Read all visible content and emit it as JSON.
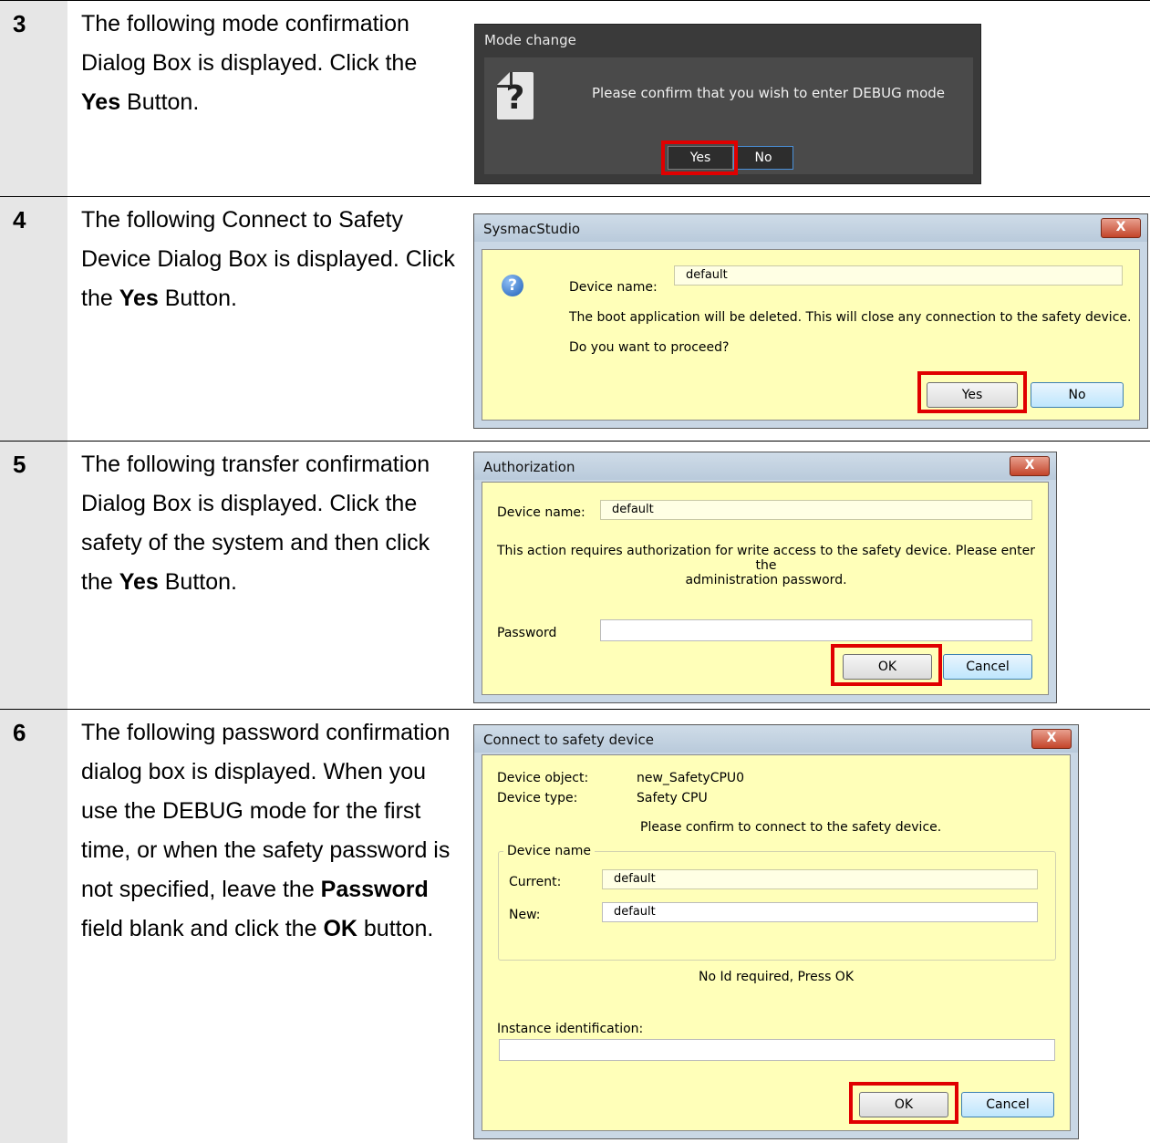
{
  "steps": [
    {
      "number": "3",
      "text_parts": [
        "The following mode confirmation Dialog Box is displayed. Click the ",
        "Yes",
        " Button."
      ],
      "dialog": {
        "title": "Mode change",
        "message": "Please confirm that you wish to enter DEBUG mode",
        "yes_label": "Yes",
        "no_label": "No",
        "icon": "question-file-icon"
      }
    },
    {
      "number": "4",
      "text_parts": [
        "The following Connect to Safety Device Dialog Box is displayed. Click the ",
        "Yes",
        " Button."
      ],
      "dialog": {
        "title": "SysmacStudio",
        "close_label": "X",
        "device_name_label": "Device name:",
        "device_name_value": "default",
        "message": "The boot application will be deleted. This will close any connection to the safety device.",
        "question": "Do you want to proceed?",
        "yes_label": "Yes",
        "no_label": "No",
        "icon": "question-icon"
      }
    },
    {
      "number": "5",
      "text_parts": [
        "The following transfer confirmation Dialog Box is displayed. Click the safety of the system and then click the ",
        "Yes",
        " Button."
      ],
      "dialog": {
        "title": "Authorization",
        "close_label": "X",
        "device_name_label": "Device name:",
        "device_name_value": "default",
        "message_line1": "This action requires authorization for write access to the safety device. Please enter the",
        "message_line2": "administration password.",
        "password_label": "Password",
        "password_value": "",
        "ok_label": "OK",
        "cancel_label": "Cancel"
      }
    },
    {
      "number": "6",
      "text_parts": [
        "The following password confirmation dialog box is displayed. When you use the DEBUG mode for the first time, or when the safety password is not specified, leave the ",
        "Password",
        " field blank and click the ",
        "OK",
        " button."
      ],
      "dialog": {
        "title": "Connect to safety device",
        "close_label": "X",
        "device_object_label": "Device object:",
        "device_object_value": "new_SafetyCPU0",
        "device_type_label": "Device type:",
        "device_type_value": "Safety CPU",
        "confirm_message": "Please confirm to connect to the safety device.",
        "group_label": "Device name",
        "current_label": "Current:",
        "current_value": "default",
        "new_label": "New:",
        "new_value": "default",
        "id_message": "No Id required, Press OK",
        "instance_label": "Instance identification:",
        "instance_value": "",
        "ok_label": "OK",
        "cancel_label": "Cancel"
      }
    }
  ]
}
